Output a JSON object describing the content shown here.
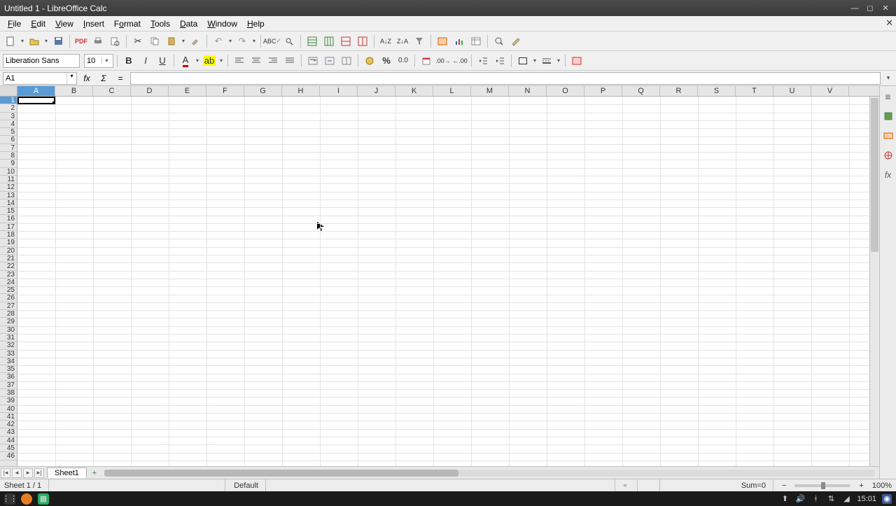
{
  "window": {
    "title": "Untitled 1 - LibreOffice Calc"
  },
  "menu": {
    "file": "File",
    "edit": "Edit",
    "view": "View",
    "insert": "Insert",
    "format": "Format",
    "tools": "Tools",
    "data": "Data",
    "window": "Window",
    "help": "Help"
  },
  "font": {
    "name": "Liberation Sans",
    "size": "10"
  },
  "namebox": {
    "value": "A1"
  },
  "formula": {
    "value": ""
  },
  "columns": [
    "A",
    "B",
    "C",
    "D",
    "E",
    "F",
    "G",
    "H",
    "I",
    "J",
    "K",
    "L",
    "M",
    "N",
    "O",
    "P",
    "Q",
    "R",
    "S",
    "T",
    "U",
    "V"
  ],
  "active_column_index": 0,
  "row_count": 46,
  "active_row": 1,
  "sheet_tabs": {
    "current": "Sheet1"
  },
  "status": {
    "sheet_position": "Sheet 1 / 1",
    "page_style": "Default",
    "sum": "Sum=0",
    "zoom": "100%"
  },
  "taskbar": {
    "clock": "15:01"
  }
}
